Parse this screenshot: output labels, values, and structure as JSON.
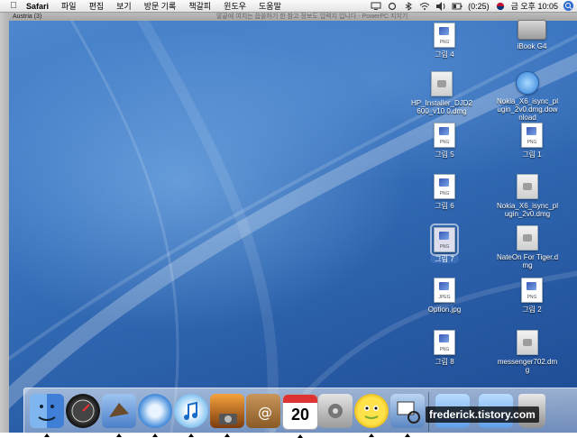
{
  "menubar": {
    "apple": "",
    "app": "Safari",
    "items": [
      "파일",
      "편집",
      "보기",
      "방문 기록",
      "책갈피",
      "윈도우",
      "도움말"
    ],
    "battery": "(0:25)",
    "clock": "금 오후 10:05"
  },
  "background_window": {
    "left_text": "Austria (3)",
    "title": "말끝에 여치는 씁쓸하기 한 참고 정보도 입력지 입니다 - PowerPC 지지기"
  },
  "desktop_icons": [
    {
      "label": "그림 4",
      "type": "png"
    },
    {
      "label": "iBook G4",
      "type": "harddisk"
    },
    {
      "label": "HP_Installer_DJD2600_v10.0.dmg",
      "type": "dmg"
    },
    {
      "label": "Nokia_X6_isync_plugin_2v0.dmg.download",
      "type": "download"
    },
    {
      "label": "그림 5",
      "type": "png"
    },
    {
      "label": "그림 1",
      "type": "png"
    },
    {
      "label": "그림 6",
      "type": "png"
    },
    {
      "label": "Nokia_X6_isync_plugin_2v0.dmg",
      "type": "dmg"
    },
    {
      "label": "그림 7",
      "type": "png",
      "selected": true
    },
    {
      "label": "NateOn For Tiger.dmg",
      "type": "dmg"
    },
    {
      "label": "Option.jpg",
      "type": "jpeg"
    },
    {
      "label": "그림 2",
      "type": "png"
    },
    {
      "label": "그림 8",
      "type": "png"
    },
    {
      "label": "messenger702.dmg",
      "type": "dmg"
    }
  ],
  "icon_tags": {
    "png": "PNG",
    "jpeg": "JPEG"
  },
  "dock": {
    "items": [
      "finder-icon",
      "dashboard-icon",
      "mail-icon",
      "safari-icon",
      "itunes-icon",
      "iphoto-icon",
      "address-book-icon",
      "ical-icon",
      "system-preferences-icon",
      "messenger-icon",
      "preview-icon",
      "applications-folder-icon",
      "documents-folder-icon",
      "trash-icon"
    ],
    "ical_date": "20"
  },
  "watermark": "frederick.tistory.com",
  "colors": {
    "desktop_blue": "#3a75c0",
    "selection": "#3d6fb8"
  }
}
